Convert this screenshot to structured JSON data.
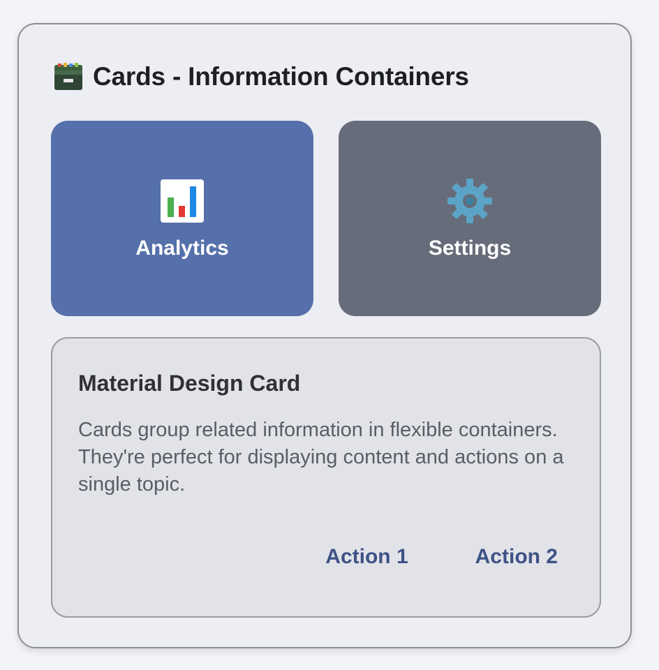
{
  "header": {
    "icon": "card-index-icon",
    "title": "Cards - Information Containers"
  },
  "tiles": [
    {
      "label": "Analytics",
      "icon": "bar-chart-icon",
      "color": "#5570aa"
    },
    {
      "label": "Settings",
      "icon": "gear-icon",
      "color": "#666c79"
    }
  ],
  "material_card": {
    "title": "Material Design Card",
    "body": "Cards group related information in flexible containers. They're perfect for displaying content and actions on a single topic.",
    "actions": [
      "Action 1",
      "Action 2"
    ]
  },
  "colors": {
    "accent": "#3e5287",
    "analytics_tile": "#5570aa",
    "settings_tile": "#666c79"
  }
}
